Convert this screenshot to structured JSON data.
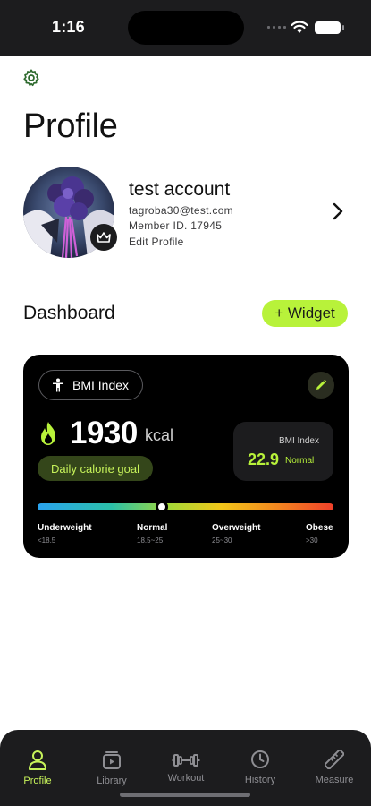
{
  "status_bar": {
    "time": "1:16"
  },
  "header": {
    "title": "Profile",
    "settings_icon": "gear-icon"
  },
  "profile": {
    "name": "test account",
    "email": "tagroba30@test.com",
    "member_id": "Member ID. 17945",
    "edit_label": "Edit Profile",
    "badge_icon": "crown-icon"
  },
  "dashboard": {
    "title": "Dashboard",
    "widget_button": "+ Widget"
  },
  "bmi_card": {
    "chip_label": "BMI Index",
    "calories": "1930",
    "calories_unit": "kcal",
    "goal_label": "Daily calorie goal",
    "bmi_label": "BMI Index",
    "bmi_value": "22.9",
    "bmi_status": "Normal",
    "marker_fraction": 0.42,
    "scale": [
      {
        "label": "Underweight",
        "range": "<18.5"
      },
      {
        "label": "Normal",
        "range": "18.5~25"
      },
      {
        "label": "Overweight",
        "range": "25~30"
      },
      {
        "label": "Obese",
        "range": ">30"
      }
    ]
  },
  "tabs": [
    {
      "label": "Profile",
      "icon": "person-icon",
      "active": true
    },
    {
      "label": "Library",
      "icon": "library-icon",
      "active": false
    },
    {
      "label": "Workout",
      "icon": "dumbbell-icon",
      "active": false
    },
    {
      "label": "History",
      "icon": "clock-icon",
      "active": false
    },
    {
      "label": "Measure",
      "icon": "ruler-icon",
      "active": false
    }
  ],
  "colors": {
    "accent": "#b8f23a",
    "card_bg": "#000000",
    "tab_bar_bg": "#1c1c1e"
  }
}
